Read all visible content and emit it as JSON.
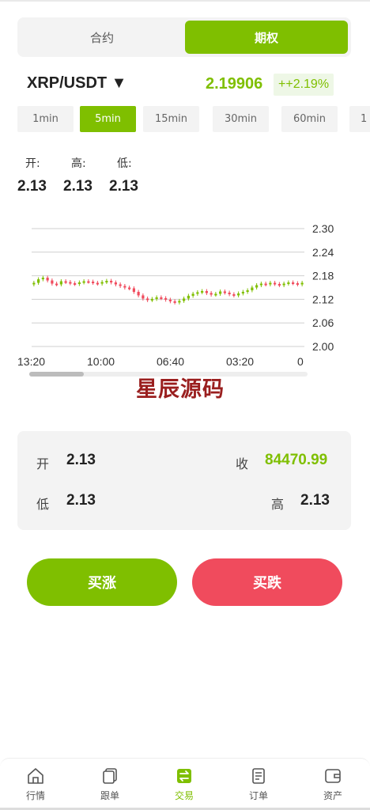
{
  "segment": {
    "tab_contract": "合约",
    "tab_option": "期权"
  },
  "market": {
    "pair": "XRP/USDT ▼",
    "price": "2.19906",
    "change": "++2.19%"
  },
  "intervals": [
    "1min",
    "5min",
    "15min",
    "30min",
    "60min",
    "1"
  ],
  "active_interval": "5min",
  "stats_top": {
    "open_label": "开:",
    "high_label": "高:",
    "low_label": "低:",
    "open": "2.13",
    "high": "2.13",
    "low": "2.13"
  },
  "watermark": "星辰源码",
  "chart_data": {
    "type": "candlestick",
    "y_ticks": [
      "2.30",
      "2.24",
      "2.18",
      "2.12",
      "2.06",
      "2.00"
    ],
    "ylim": [
      2.0,
      2.3
    ],
    "x_ticks": [
      "13:20",
      "10:00",
      "06:40",
      "03:20",
      "0"
    ],
    "series": [
      {
        "values": [
          2.162,
          2.171,
          2.175,
          2.168,
          2.16,
          2.158,
          2.166,
          2.164,
          2.161,
          2.159,
          2.163,
          2.166,
          2.165,
          2.162,
          2.16,
          2.164,
          2.167,
          2.163,
          2.158,
          2.154,
          2.15,
          2.148,
          2.139,
          2.13,
          2.122,
          2.118,
          2.121,
          2.125,
          2.123,
          2.119,
          2.115,
          2.112,
          2.116,
          2.122,
          2.129,
          2.134,
          2.138,
          2.141,
          2.136,
          2.132,
          2.134,
          2.14,
          2.137,
          2.133,
          2.13,
          2.135,
          2.139,
          2.143,
          2.15,
          2.156,
          2.16,
          2.158,
          2.162,
          2.159,
          2.156,
          2.16,
          2.163,
          2.161,
          2.158,
          2.162
        ]
      }
    ],
    "up_color": "#7fbf00",
    "down_color": "#f04b5d",
    "grid": true
  },
  "stats_panel": {
    "open_label": "开",
    "open": "2.13",
    "close_label": "收",
    "close": "84470.99",
    "low_label": "低",
    "low": "2.13",
    "high_label": "高",
    "high": "2.13"
  },
  "actions": {
    "buy_up": "买涨",
    "buy_down": "买跌"
  },
  "tabbar": [
    {
      "label": "行情",
      "icon": "home-icon"
    },
    {
      "label": "跟单",
      "icon": "copy-icon"
    },
    {
      "label": "交易",
      "icon": "exchange-icon"
    },
    {
      "label": "订单",
      "icon": "order-icon"
    },
    {
      "label": "资产",
      "icon": "wallet-icon"
    }
  ],
  "colors": {
    "accent": "#7fbf00",
    "down": "#f04b5d",
    "panel": "#f3f3f3"
  }
}
